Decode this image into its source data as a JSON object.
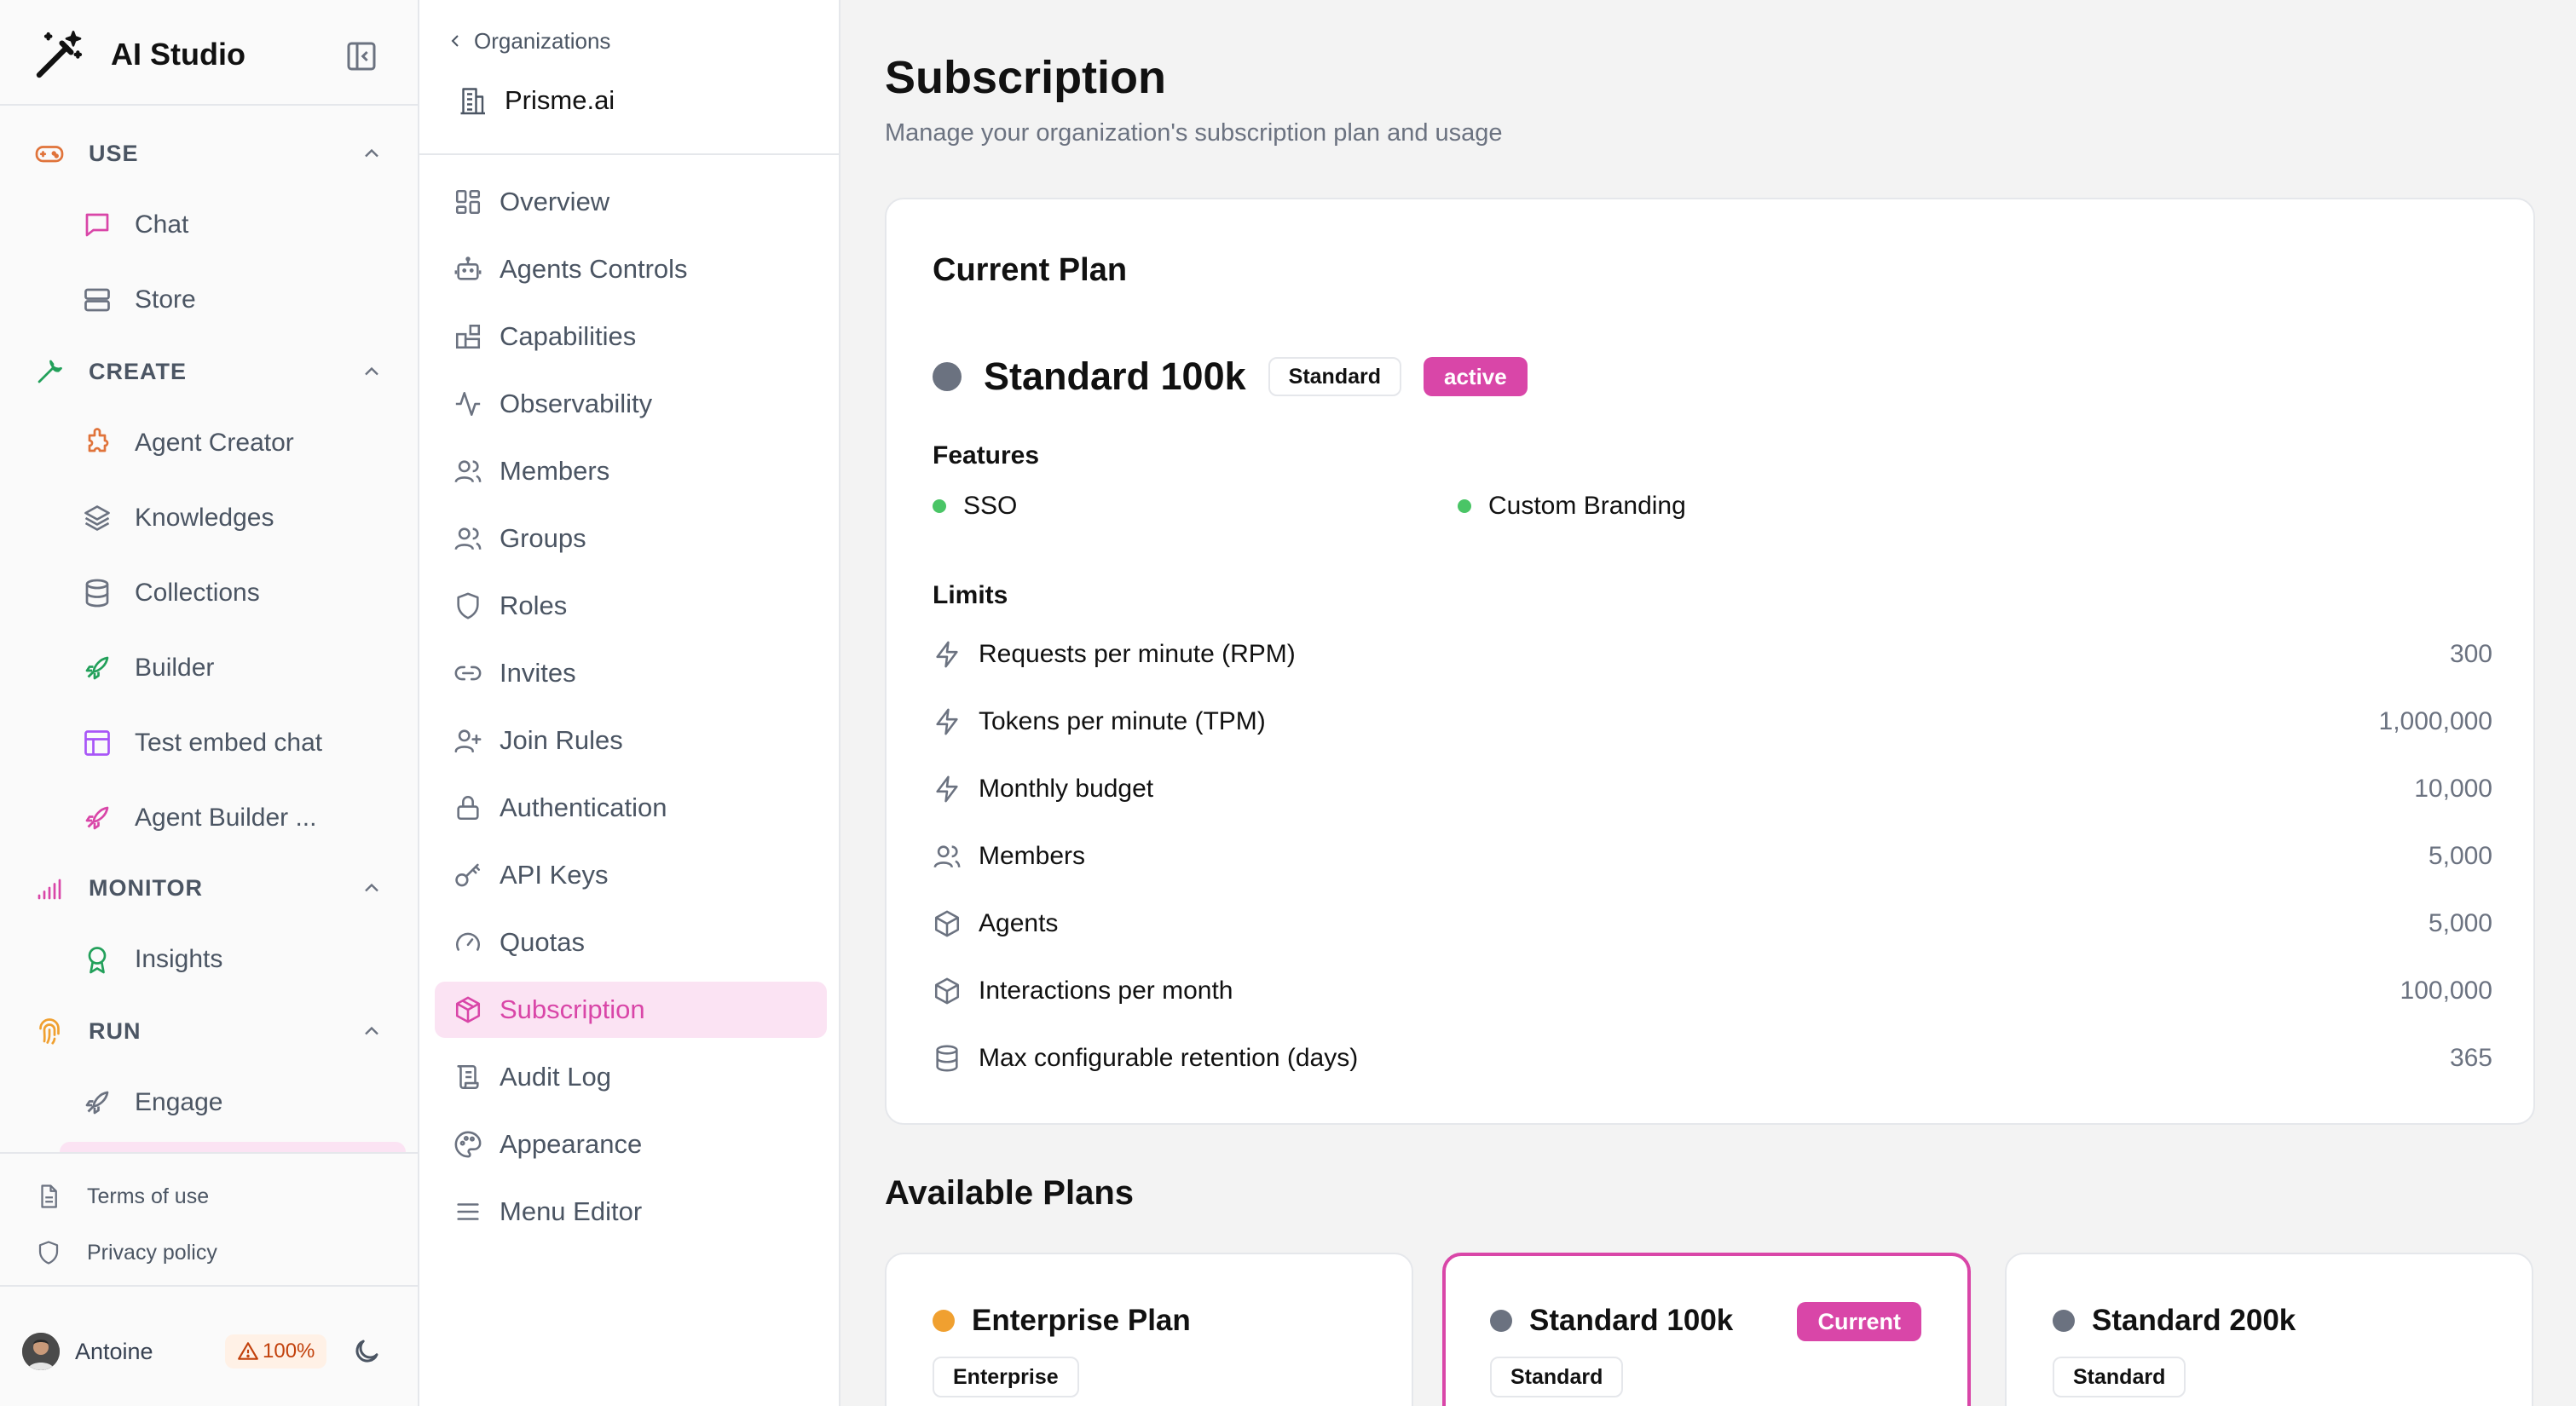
{
  "app": {
    "title": "AI Studio"
  },
  "sidebar": {
    "sections": [
      {
        "label": "USE",
        "items": [
          "Chat",
          "Store"
        ]
      },
      {
        "label": "CREATE",
        "items": [
          "Agent Creator",
          "Knowledges",
          "Collections",
          "Builder",
          "Test embed chat",
          "Agent Builder ..."
        ]
      },
      {
        "label": "MONITOR",
        "items": [
          "Insights"
        ]
      },
      {
        "label": "RUN",
        "items": [
          "Engage"
        ]
      }
    ],
    "footer_links": [
      "Terms of use",
      "Privacy policy"
    ],
    "user": {
      "name": "Antoine",
      "quota": "100%"
    }
  },
  "orgnav": {
    "back_label": "Organizations",
    "org_name": "Prisme.ai",
    "items": [
      "Overview",
      "Agents Controls",
      "Capabilities",
      "Observability",
      "Members",
      "Groups",
      "Roles",
      "Invites",
      "Join Rules",
      "Authentication",
      "API Keys",
      "Quotas",
      "Subscription",
      "Audit Log",
      "Appearance",
      "Menu Editor"
    ],
    "active": "Subscription"
  },
  "page": {
    "title": "Subscription",
    "subtitle": "Manage your organization's subscription plan and usage"
  },
  "current_plan": {
    "heading": "Current Plan",
    "name": "Standard 100k",
    "tier": "Standard",
    "status": "active",
    "features_heading": "Features",
    "features": [
      "SSO",
      "Custom Branding"
    ],
    "limits_heading": "Limits",
    "limits": [
      {
        "label": "Requests per minute (RPM)",
        "value": "300",
        "icon": "bolt-icon"
      },
      {
        "label": "Tokens per minute (TPM)",
        "value": "1,000,000",
        "icon": "bolt-icon"
      },
      {
        "label": "Monthly budget",
        "value": "10,000",
        "icon": "bolt-icon"
      },
      {
        "label": "Members",
        "value": "5,000",
        "icon": "users-icon"
      },
      {
        "label": "Agents",
        "value": "5,000",
        "icon": "box-icon"
      },
      {
        "label": "Interactions per month",
        "value": "100,000",
        "icon": "box-icon"
      },
      {
        "label": "Max configurable retention (days)",
        "value": "365",
        "icon": "database-icon"
      }
    ]
  },
  "available": {
    "heading": "Available Plans",
    "plans": [
      {
        "name": "Enterprise Plan",
        "tier": "Enterprise",
        "dot_color": "#f0a030",
        "current": false
      },
      {
        "name": "Standard 100k",
        "tier": "Standard",
        "dot_color": "#6b7280",
        "current": true,
        "badge": "Current"
      },
      {
        "name": "Standard 200k",
        "tier": "Standard",
        "dot_color": "#6b7280",
        "current": false
      }
    ]
  },
  "colors": {
    "accent": "#d946a8",
    "accent_soft": "#fbe3f3",
    "feature_dot": "#4ac566",
    "warning": "#c2410c"
  }
}
